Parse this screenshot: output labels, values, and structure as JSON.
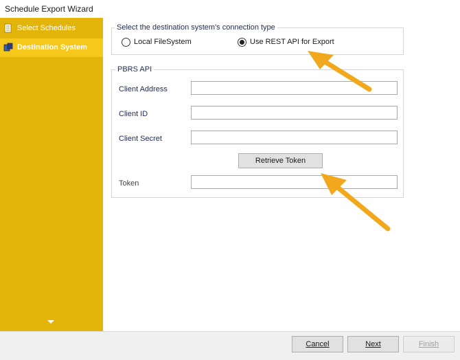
{
  "window": {
    "title": "Schedule Export Wizard"
  },
  "sidebar": {
    "items": [
      {
        "label": "Select Schedules",
        "active": false
      },
      {
        "label": "Destination System",
        "active": true
      }
    ]
  },
  "connection": {
    "group_title": "Select the destination system's connection type",
    "local_label": "Local FileSystem",
    "rest_label": "Use REST API for Export",
    "selected": "rest"
  },
  "pbrs": {
    "group_title": "PBRS API",
    "client_address_label": "Client Address",
    "client_address_value": "",
    "client_id_label": "Client ID",
    "client_id_value": "",
    "client_secret_label": "Client Secret",
    "client_secret_value": "",
    "retrieve_token_label": "Retrieve Token",
    "token_label": "Token",
    "token_value": ""
  },
  "footer": {
    "cancel_label": "Cancel",
    "next_label": "Next",
    "finish_label": "Finish"
  },
  "colors": {
    "sidebar": "#e3b409",
    "sidebar_active": "#f6c81a",
    "annotation_arrow": "#f2a81d"
  }
}
